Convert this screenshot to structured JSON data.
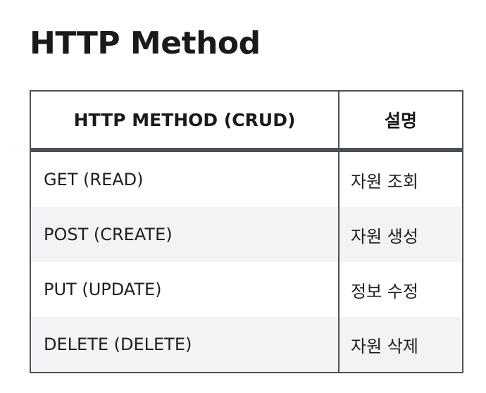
{
  "page": {
    "title": "HTTP Method"
  },
  "table": {
    "headers": [
      "HTTP METHOD (CRUD)",
      "설명"
    ],
    "rows": [
      {
        "method": "GET (READ)",
        "description": "자원 조회"
      },
      {
        "method": "POST (CREATE)",
        "description": "자원 생성"
      },
      {
        "method": "PUT (UPDATE)",
        "description": "정보 수정"
      },
      {
        "method": "DELETE (DELETE)",
        "description": "자원 삭제"
      }
    ],
    "colors": {
      "border": "#4a5059",
      "stripe": "#f2f3f5"
    }
  }
}
